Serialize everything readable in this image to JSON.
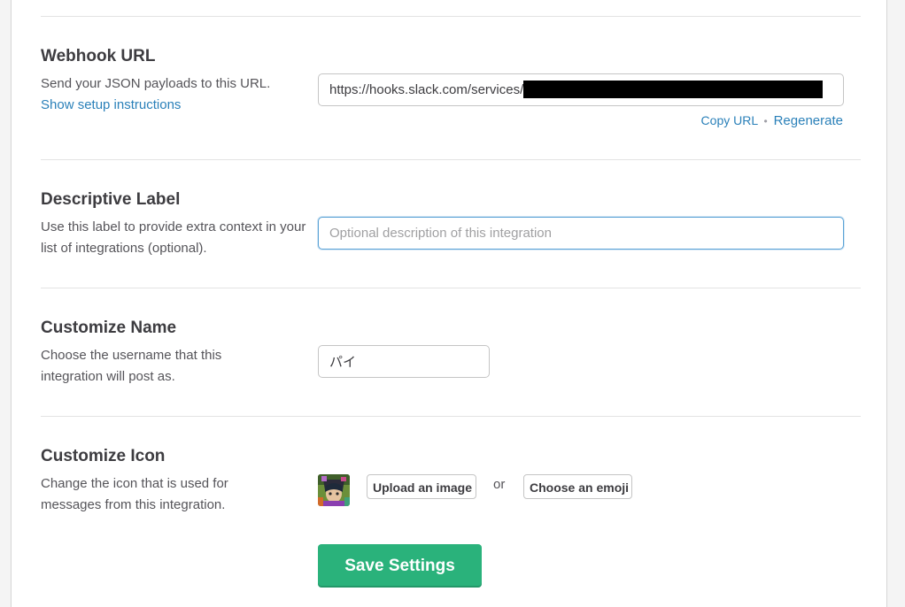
{
  "webhook": {
    "title": "Webhook URL",
    "description": "Send your JSON payloads to this URL.",
    "setup_link": "Show setup instructions",
    "url_prefix": "https://hooks.slack.com/services/",
    "copy_url": "Copy URL",
    "separator": "•",
    "regenerate": "Regenerate"
  },
  "label": {
    "title": "Descriptive Label",
    "description": "Use this label to provide extra context in your list of integrations (optional).",
    "placeholder": "Optional description of this integration",
    "value": ""
  },
  "name": {
    "title": "Customize Name",
    "description": "Choose the username that this integration will post as.",
    "value": "パイ"
  },
  "icon": {
    "title": "Customize Icon",
    "description": "Change the icon that is used for messages from this integration.",
    "upload_label": "Upload an image",
    "or_text": "or",
    "emoji_label": "Choose an emoji"
  },
  "save_label": "Save Settings",
  "colors": {
    "link": "#2a80b9",
    "save_button": "#2ab27b",
    "focus_border": "#5aa2d6"
  }
}
